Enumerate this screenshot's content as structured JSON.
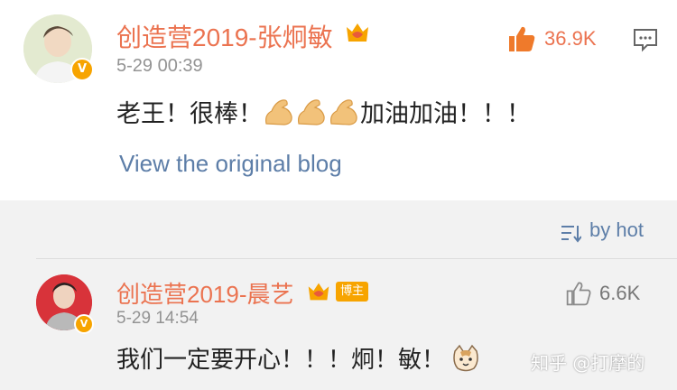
{
  "post": {
    "author": "创造营2019-张炯敏",
    "time": "5-29 00:39",
    "text_before": "老王！很棒！",
    "text_after": "加油加油！！！",
    "emoji_count": 3,
    "emoji_name": "flexed-biceps-emoji",
    "like_count": "36.9K",
    "view_original": "View the original blog"
  },
  "sort": {
    "label": "by hot"
  },
  "comment": {
    "author": "创造营2019-晨艺",
    "tag": "博主",
    "time": "5-29 14:54",
    "text": "我们一定要开心！！！炯！敏！",
    "emoji_name": "cat-face-emoji",
    "like_count": "6.6K"
  },
  "watermark": "知乎 @打摩的",
  "colors": {
    "name": "#eb7350",
    "link": "#5d7ea8",
    "verified": "#f7a400",
    "muted": "#939393"
  }
}
